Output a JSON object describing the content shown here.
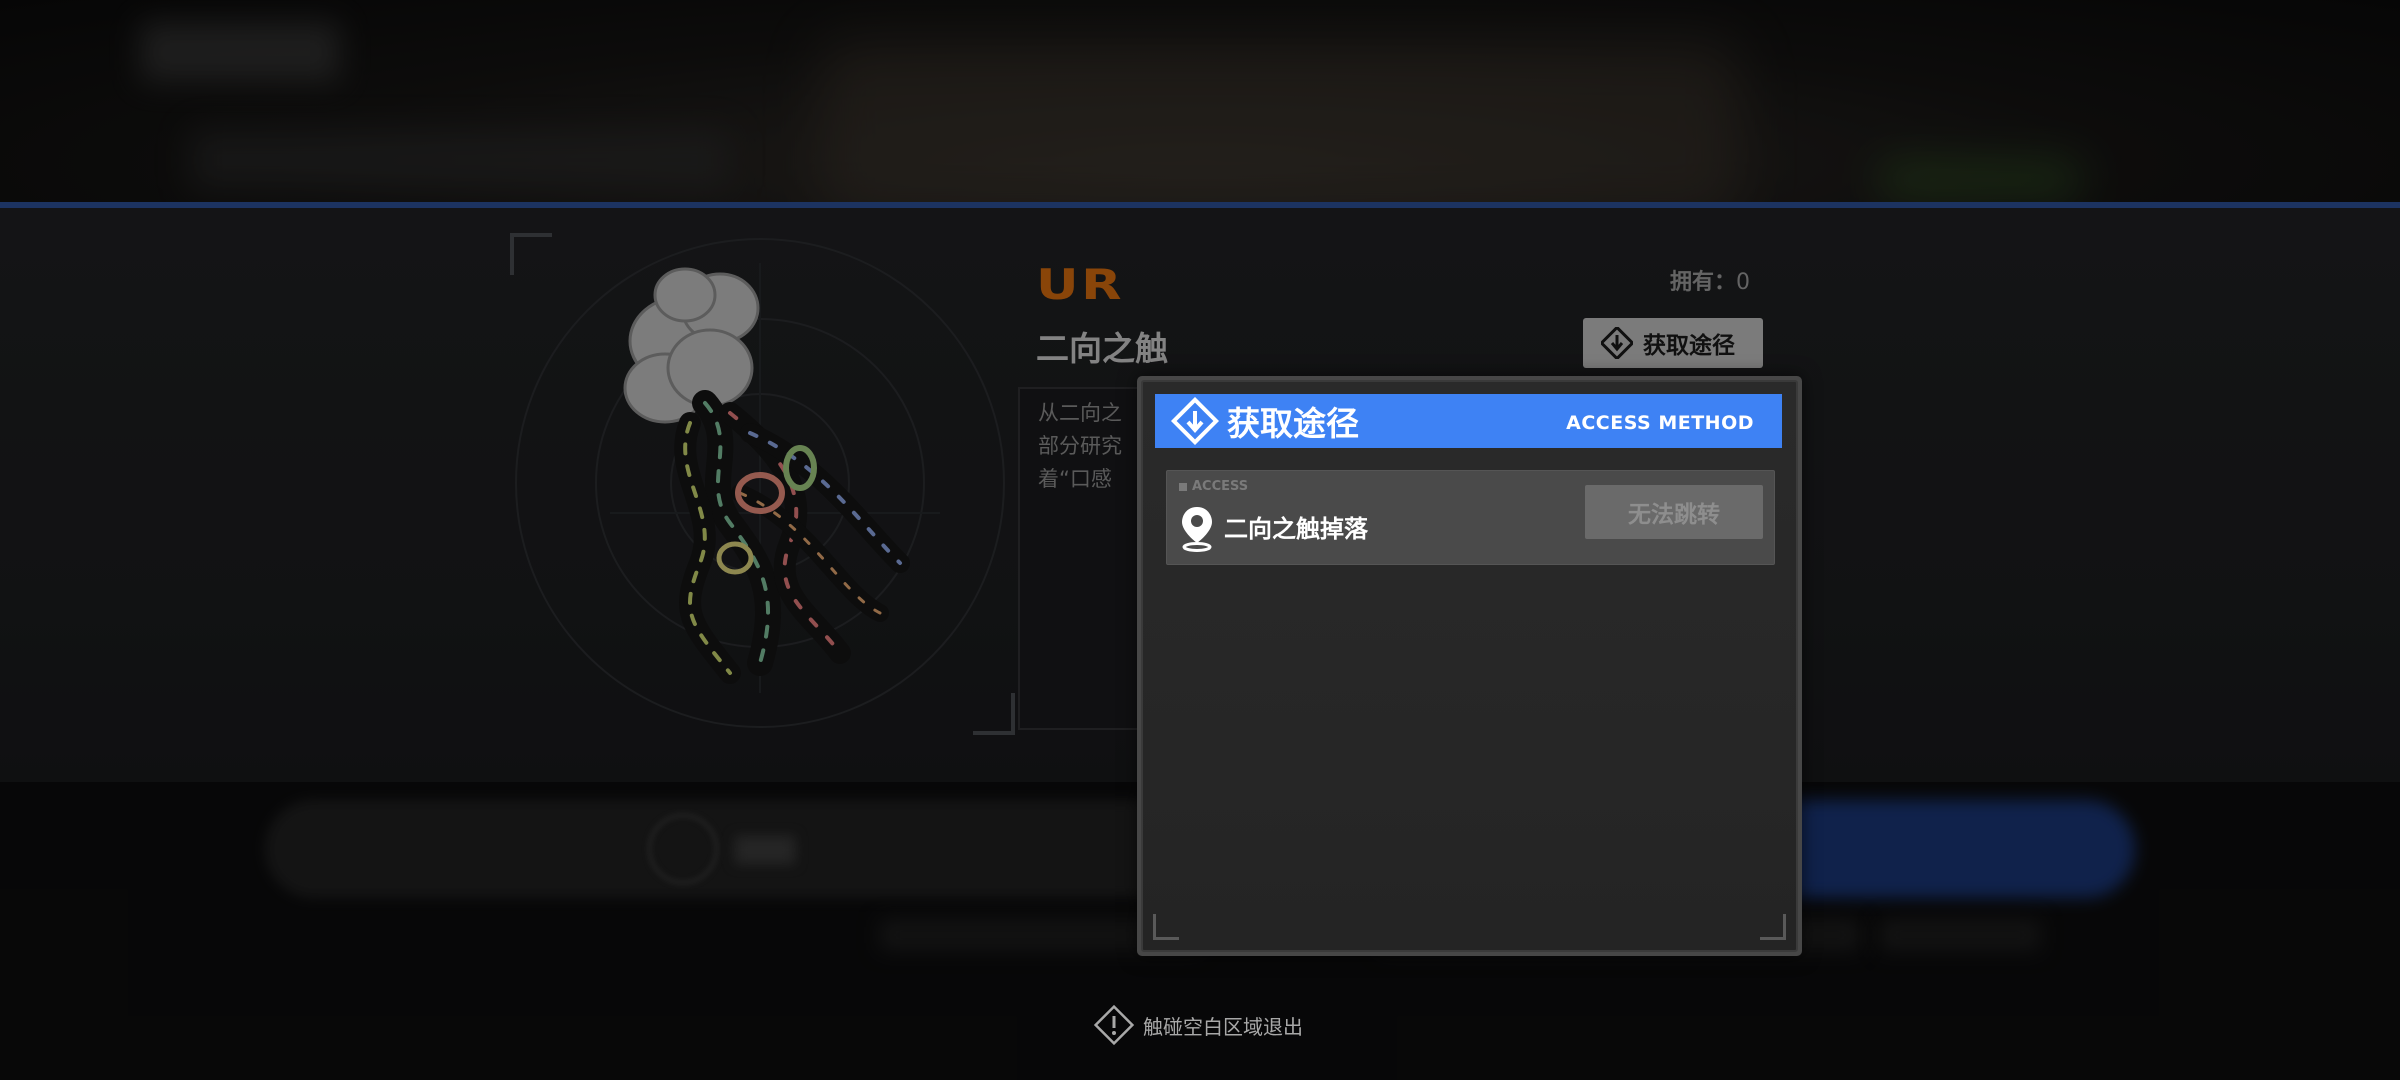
{
  "item": {
    "rarity": "UR",
    "name": "二向之触",
    "owned_label": "拥有：",
    "owned_count": "0",
    "access_button": "获取途径",
    "description_lines": [
      "从二向之",
      "部分研究",
      "着“口感"
    ]
  },
  "modal": {
    "title": "获取途径",
    "subtitle": "ACCESS METHOD",
    "sources": [
      {
        "tag": "ACCESS",
        "label": "二向之触掉落",
        "button": "无法跳转"
      }
    ]
  },
  "footer": {
    "exit_hint": "触碰空白区域退出"
  },
  "colors": {
    "rarity": "#d36a0e",
    "modal_header": "#3e82f4",
    "divider": "#2c4f95"
  }
}
